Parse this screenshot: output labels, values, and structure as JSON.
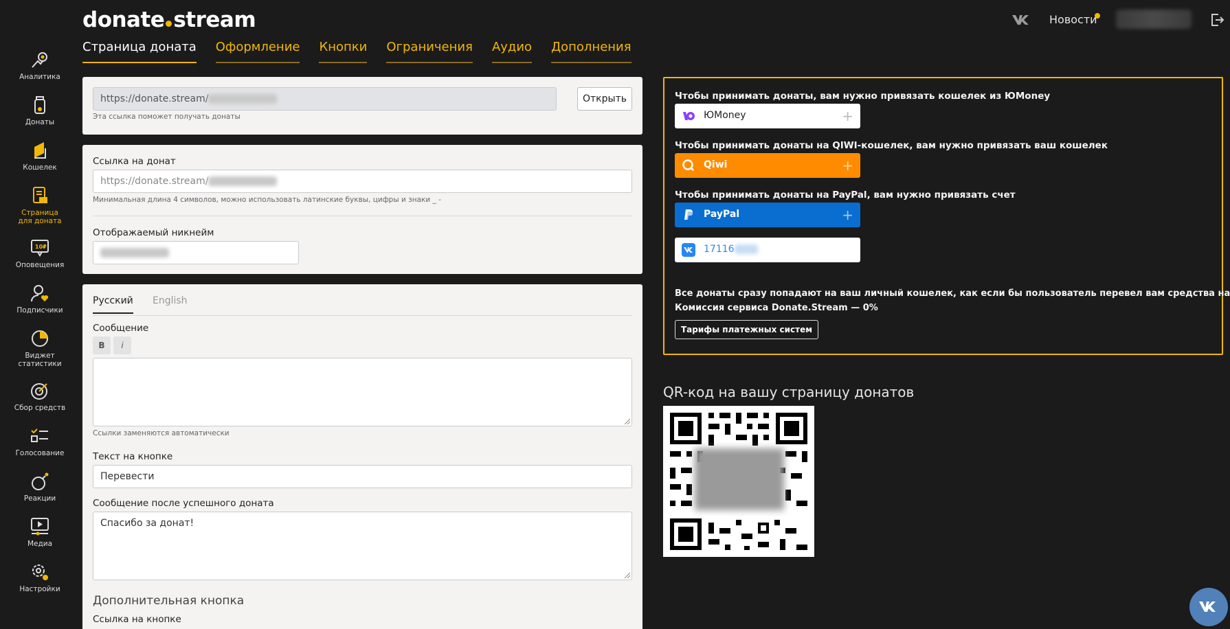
{
  "header": {
    "logo_left": "donate",
    "logo_right": "stream",
    "news_label": "Новости"
  },
  "tabs": [
    {
      "label": "Страница доната"
    },
    {
      "label": "Оформление"
    },
    {
      "label": "Кнопки"
    },
    {
      "label": "Ограничения"
    },
    {
      "label": "Аудио"
    },
    {
      "label": "Дополнения"
    }
  ],
  "sidebar": {
    "items": [
      {
        "label": "Аналитика"
      },
      {
        "label": "Донаты"
      },
      {
        "label": "Кошелек"
      },
      {
        "label": "Страница\nдля доната"
      },
      {
        "label": "Оповещения"
      },
      {
        "label": "Подписчики"
      },
      {
        "label": "Виджет\nстатистики"
      },
      {
        "label": "Сбор средств"
      },
      {
        "label": "Голосование"
      },
      {
        "label": "Реакции"
      },
      {
        "label": "Медиа"
      },
      {
        "label": "Настройки"
      }
    ]
  },
  "link_panel": {
    "url_prefix": "https://donate.stream/",
    "open_label": "Открыть",
    "hint": "Эта ссылка поможет получать донаты"
  },
  "settings_panel": {
    "link_label": "Ссылка на донат",
    "link_placeholder": "https://donate.stream/",
    "link_hint": "Минимальная длина 4 символов, можно использовать латинские буквы, цифры и знаки _ -",
    "nickname_label": "Отображаемый никнейм"
  },
  "message_panel": {
    "lang_ru": "Русский",
    "lang_en": "English",
    "message_label": "Сообщение",
    "bold_label": "B",
    "italic_label": "i",
    "message_hint": "Ссылки заменяются автоматически",
    "button_text_label": "Текст на кнопке",
    "button_text_value": "Перевести",
    "success_label": "Сообщение после успешного доната",
    "success_value": "Спасибо за донат!",
    "extra_title": "Дополнительная кнопка",
    "extra_link_label": "Ссылка на кнопке"
  },
  "wallets": {
    "yoomoney_text": "Чтобы принимать донаты, вам нужно привязать кошелек из ЮMoney",
    "yoomoney_name": "ЮMoney",
    "qiwi_text": "Чтобы принимать донаты на QIWI-кошелек, вам нужно привязать ваш кошелек",
    "qiwi_name": "Qiwi",
    "paypal_text": "Чтобы принимать донаты на PayPal, вам нужно привязать счет",
    "paypal_name": "PayPal",
    "vk_id": "17116",
    "plus": "+",
    "info_line1": "Все донаты сразу попадают на ваш личный кошелек, как если бы пользователь перевел вам средства напрямую",
    "info_line2": "Комиссия сервиса Donate.Stream — 0%",
    "tariffs_label": "Тарифы платежных систем"
  },
  "qr": {
    "title": "QR-код на вашу страницу донатов"
  },
  "colors": {
    "accent": "#f2b705",
    "background": "#1b1b1b",
    "qiwi": "#ff8c00",
    "paypal": "#0a6ed0",
    "vk": "#5181b8"
  }
}
